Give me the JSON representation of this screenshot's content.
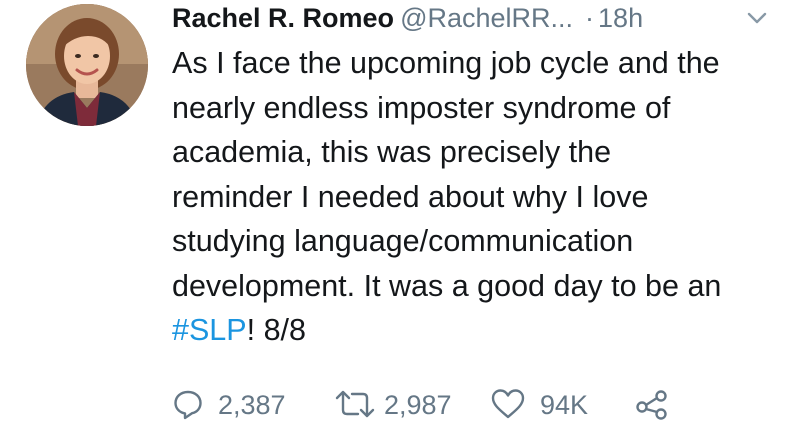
{
  "tweet": {
    "display_name": "Rachel R. Romeo",
    "handle": "@RachelRR...",
    "separator": "·",
    "time": "18h",
    "text_lines": [
      "As I face the upcoming job cycle and the",
      "nearly endless imposter syndrome of",
      "academia, this was precisely the",
      "reminder I needed about why I love",
      "studying language/communication",
      "development. It was a good day to be an"
    ],
    "last_line": {
      "hashtag": "#SLP",
      "suffix": "! 8/8"
    },
    "reply_count": "2,387",
    "retweet_count": "2,987",
    "like_count": "94K",
    "icons": {
      "avatar": "profile-photo",
      "caret": "chevron-down-icon",
      "reply": "reply-icon",
      "retweet": "retweet-icon",
      "like": "heart-icon",
      "share": "share-icon"
    },
    "colors": {
      "text": "#14171a",
      "muted": "#657786",
      "hashtag": "#1b95e0"
    }
  }
}
